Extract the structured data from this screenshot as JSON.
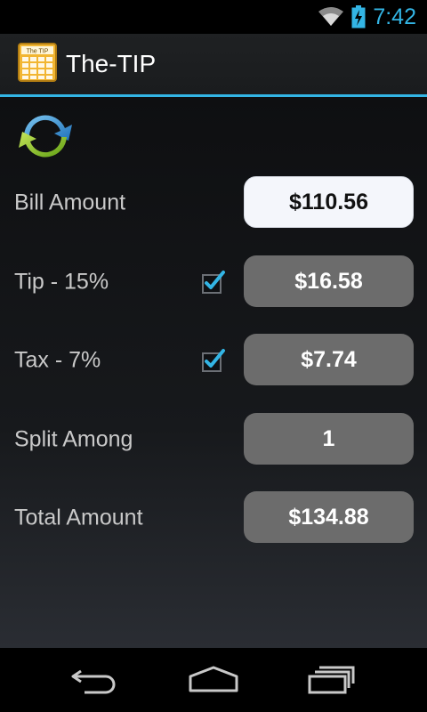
{
  "status_bar": {
    "time": "7:42",
    "icons": [
      "wifi-icon",
      "battery-charging-icon"
    ]
  },
  "app": {
    "title": "The-TIP",
    "icon": "calculator-icon",
    "accent_color": "#33b5e5"
  },
  "toolbar": {
    "refresh_icon": "refresh-icon"
  },
  "form": {
    "bill": {
      "label": "Bill Amount",
      "value": "$110.56"
    },
    "tip": {
      "label": "Tip - 15%",
      "value": "$16.58",
      "checked": true
    },
    "tax": {
      "label": "Tax - 7%",
      "value": "$7.74",
      "checked": true
    },
    "split": {
      "label": "Split Among",
      "value": "1"
    },
    "total": {
      "label": "Total Amount",
      "value": "$134.88"
    }
  },
  "nav_bar": {
    "buttons": [
      "back-icon",
      "home-icon",
      "recent-apps-icon"
    ]
  }
}
